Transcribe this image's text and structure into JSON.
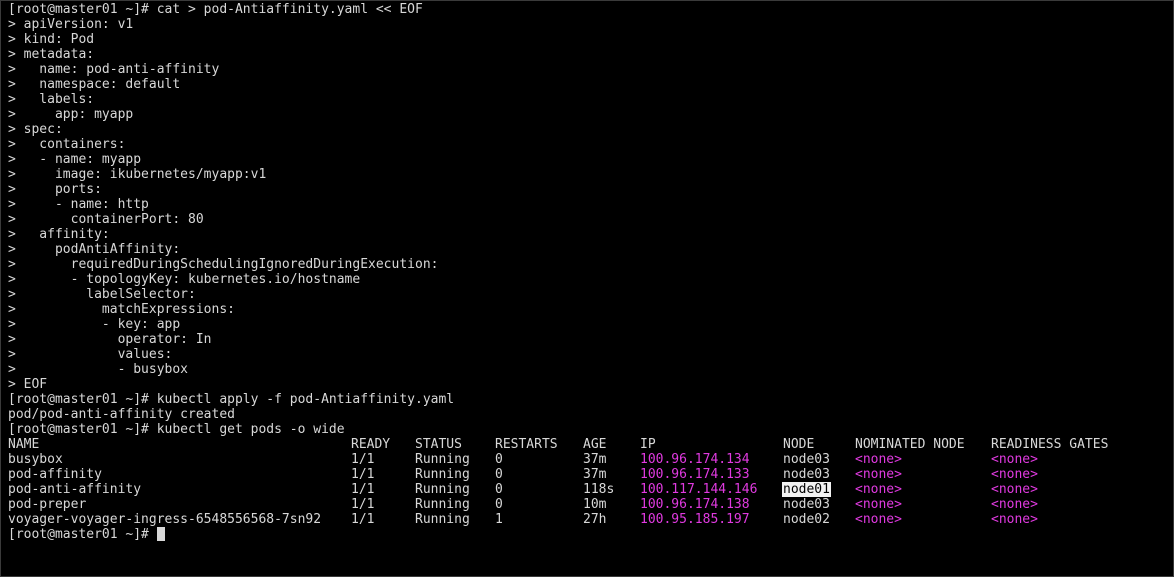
{
  "terminal": {
    "heredoc_lines": [
      "[root@master01 ~]# cat > pod-Antiaffinity.yaml << EOF",
      "> apiVersion: v1",
      "> kind: Pod",
      "> metadata:",
      ">   name: pod-anti-affinity",
      ">   namespace: default",
      ">   labels:",
      ">     app: myapp",
      "> spec:",
      ">   containers:",
      ">   - name: myapp",
      ">     image: ikubernetes/myapp:v1",
      ">     ports:",
      ">     - name: http",
      ">       containerPort: 80",
      ">   affinity:",
      ">     podAntiAffinity:",
      ">       requiredDuringSchedulingIgnoredDuringExecution:",
      ">       - topologyKey: kubernetes.io/hostname",
      ">         labelSelector:",
      ">           matchExpressions:",
      ">           - key: app",
      ">             operator: In",
      ">             values:",
      ">             - busybox",
      "> EOF"
    ],
    "apply_command": "[root@master01 ~]# kubectl apply -f pod-Antiaffinity.yaml",
    "apply_output": "pod/pod-anti-affinity created",
    "get_command": "[root@master01 ~]# kubectl get pods -o wide",
    "table": {
      "headers": {
        "name": "NAME",
        "ready": "READY",
        "status": "STATUS",
        "restarts": "RESTARTS",
        "age": "AGE",
        "ip": "IP",
        "node": "NODE",
        "nominated": "NOMINATED NODE",
        "readiness": "READINESS GATES"
      },
      "rows": [
        {
          "name": "busybox",
          "ready": "1/1",
          "status": "Running",
          "restarts": "0",
          "age": "37m",
          "ip": "100.96.174.134",
          "node": "node03",
          "nominated": "<none>",
          "readiness": "<none>"
        },
        {
          "name": "pod-affinity",
          "ready": "1/1",
          "status": "Running",
          "restarts": "0",
          "age": "37m",
          "ip": "100.96.174.133",
          "node": "node03",
          "nominated": "<none>",
          "readiness": "<none>"
        },
        {
          "name": "pod-anti-affinity",
          "ready": "1/1",
          "status": "Running",
          "restarts": "0",
          "age": "118s",
          "ip": "100.117.144.146",
          "node": "node01",
          "nominated": "<none>",
          "readiness": "<none>"
        },
        {
          "name": "pod-preper",
          "ready": "1/1",
          "status": "Running",
          "restarts": "0",
          "age": "10m",
          "ip": "100.96.174.138",
          "node": "node03",
          "nominated": "<none>",
          "readiness": "<none>"
        },
        {
          "name": "voyager-voyager-ingress-6548556568-7sn92",
          "ready": "1/1",
          "status": "Running",
          "restarts": "1",
          "age": "27h",
          "ip": "100.95.185.197",
          "node": "node02",
          "nominated": "<none>",
          "readiness": "<none>"
        }
      ]
    },
    "final_prompt": "[root@master01 ~]# ",
    "colors": {
      "background": "#000000",
      "text": "#d8d8d8",
      "ip_and_none": "#e03ae0",
      "highlight_bg": "#f2f2f2"
    }
  }
}
